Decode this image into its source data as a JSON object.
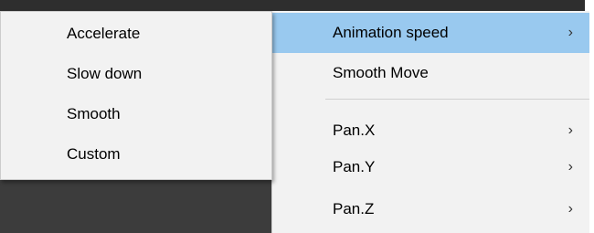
{
  "main_menu": {
    "items": [
      {
        "label": "Animation speed",
        "arrow": "›"
      },
      {
        "label": "Smooth Move",
        "arrow": ""
      },
      {
        "label": "Pan.X",
        "arrow": "›"
      },
      {
        "label": "Pan.Y",
        "arrow": "›"
      },
      {
        "label": "Pan.Z",
        "arrow": "›"
      }
    ]
  },
  "submenu": {
    "items": [
      {
        "label": "Accelerate"
      },
      {
        "label": "Slow down"
      },
      {
        "label": "Smooth"
      },
      {
        "label": "Custom"
      }
    ]
  }
}
